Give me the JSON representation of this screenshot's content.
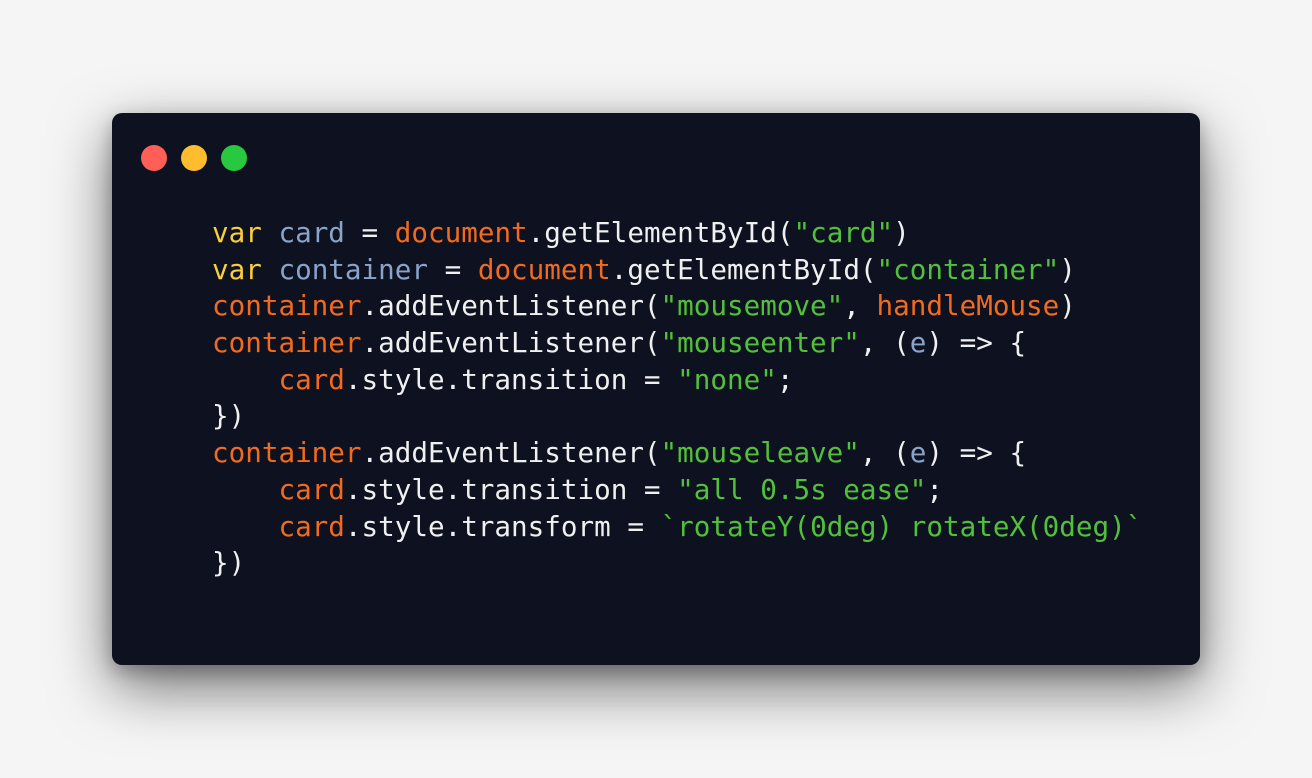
{
  "window": {
    "dots": [
      {
        "name": "close-dot",
        "color": "#ff5f57"
      },
      {
        "name": "minimize-dot",
        "color": "#febc2e"
      },
      {
        "name": "maximize-dot",
        "color": "#28c840"
      }
    ]
  },
  "colors": {
    "background": "#0d1120",
    "keyword": "#f9cf3b",
    "variable": "#8aa3c8",
    "object": "#f26b1d",
    "plain": "#f0f0f0",
    "string": "#52c13a"
  },
  "code": {
    "lines": [
      [
        {
          "t": "keyword",
          "v": "var"
        },
        {
          "t": "plain",
          "v": " "
        },
        {
          "t": "var",
          "v": "card"
        },
        {
          "t": "plain",
          "v": " = "
        },
        {
          "t": "obj",
          "v": "document"
        },
        {
          "t": "plain",
          "v": ".getElementById("
        },
        {
          "t": "string",
          "v": "\"card\""
        },
        {
          "t": "plain",
          "v": ")"
        }
      ],
      [
        {
          "t": "keyword",
          "v": "var"
        },
        {
          "t": "plain",
          "v": " "
        },
        {
          "t": "var",
          "v": "container"
        },
        {
          "t": "plain",
          "v": " = "
        },
        {
          "t": "obj",
          "v": "document"
        },
        {
          "t": "plain",
          "v": ".getElementById("
        },
        {
          "t": "string",
          "v": "\"container\""
        },
        {
          "t": "plain",
          "v": ")"
        }
      ],
      [
        {
          "t": "obj",
          "v": "container"
        },
        {
          "t": "plain",
          "v": ".addEventListener("
        },
        {
          "t": "string",
          "v": "\"mousemove\""
        },
        {
          "t": "plain",
          "v": ", "
        },
        {
          "t": "obj",
          "v": "handleMouse"
        },
        {
          "t": "plain",
          "v": ")"
        }
      ],
      [
        {
          "t": "obj",
          "v": "container"
        },
        {
          "t": "plain",
          "v": ".addEventListener("
        },
        {
          "t": "string",
          "v": "\"mouseenter\""
        },
        {
          "t": "plain",
          "v": ", ("
        },
        {
          "t": "var",
          "v": "e"
        },
        {
          "t": "plain",
          "v": ") => {"
        }
      ],
      [
        {
          "t": "plain",
          "v": "    "
        },
        {
          "t": "obj",
          "v": "card"
        },
        {
          "t": "plain",
          "v": ".style.transition = "
        },
        {
          "t": "string",
          "v": "\"none\""
        },
        {
          "t": "plain",
          "v": ";"
        }
      ],
      [
        {
          "t": "plain",
          "v": "})"
        }
      ],
      [
        {
          "t": "obj",
          "v": "container"
        },
        {
          "t": "plain",
          "v": ".addEventListener("
        },
        {
          "t": "string",
          "v": "\"mouseleave\""
        },
        {
          "t": "plain",
          "v": ", ("
        },
        {
          "t": "var",
          "v": "e"
        },
        {
          "t": "plain",
          "v": ") => {"
        }
      ],
      [
        {
          "t": "plain",
          "v": "    "
        },
        {
          "t": "obj",
          "v": "card"
        },
        {
          "t": "plain",
          "v": ".style.transition = "
        },
        {
          "t": "string",
          "v": "\"all 0.5s ease\""
        },
        {
          "t": "plain",
          "v": ";"
        }
      ],
      [
        {
          "t": "plain",
          "v": "    "
        },
        {
          "t": "obj",
          "v": "card"
        },
        {
          "t": "plain",
          "v": ".style.transform = "
        },
        {
          "t": "string",
          "v": "`rotateY(0deg) rotateX(0deg)`"
        }
      ],
      [
        {
          "t": "plain",
          "v": "})"
        }
      ]
    ]
  }
}
